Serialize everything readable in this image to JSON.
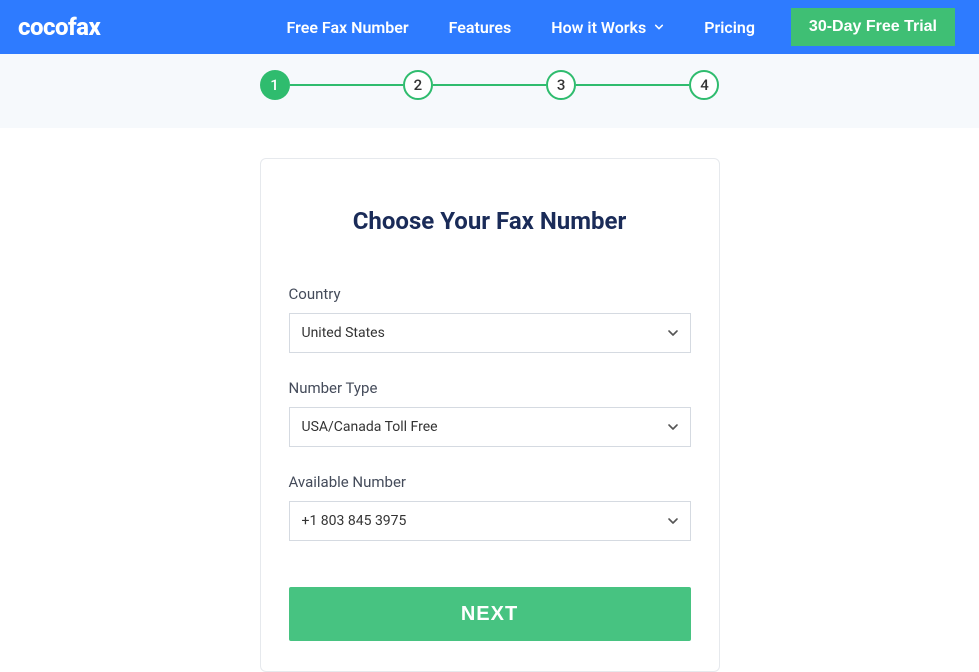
{
  "header": {
    "logo": "cocofax",
    "nav": {
      "free_fax": "Free Fax Number",
      "features": "Features",
      "how_it_works": "How it Works",
      "pricing": "Pricing"
    },
    "trial_btn": "30-Day Free Trial"
  },
  "stepper": {
    "steps": [
      "1",
      "2",
      "3",
      "4"
    ],
    "active_index": 0
  },
  "card": {
    "title": "Choose Your Fax Number",
    "country": {
      "label": "Country",
      "value": "United States"
    },
    "number_type": {
      "label": "Number Type",
      "value": "USA/Canada Toll Free"
    },
    "available_number": {
      "label": "Available Number",
      "value": "+1 803 845 3975"
    },
    "next_btn": "NEXT"
  }
}
